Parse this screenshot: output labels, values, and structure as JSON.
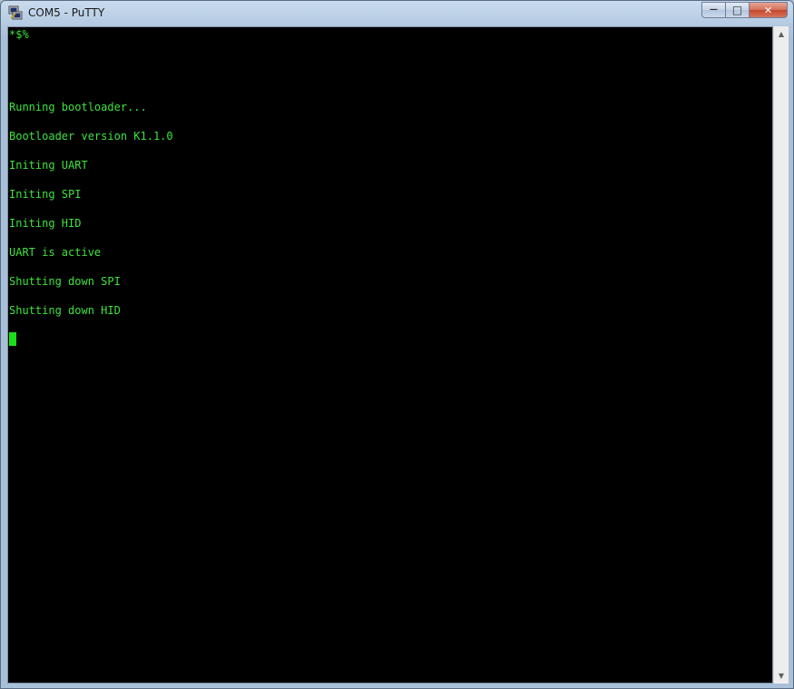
{
  "window": {
    "title": "COM5 - PuTTY",
    "icon": "putty-icon"
  },
  "caption": {
    "minimize_glyph": "—",
    "maximize_glyph": "□",
    "close_glyph": "✕"
  },
  "terminal": {
    "colors": {
      "background": "#000000",
      "foreground": "#3ce33c",
      "cursor": "#19e019"
    },
    "lines": [
      "*$%",
      "",
      "",
      "",
      "",
      "Running bootloader...",
      "",
      "Bootloader version K1.1.0",
      "",
      "Initing UART",
      "",
      "Initing SPI",
      "",
      "Initing HID",
      "",
      "UART is active",
      "",
      "Shutting down SPI",
      "",
      "Shutting down HID",
      ""
    ]
  },
  "scrollbar": {
    "up_glyph": "▲",
    "down_glyph": "▼"
  }
}
